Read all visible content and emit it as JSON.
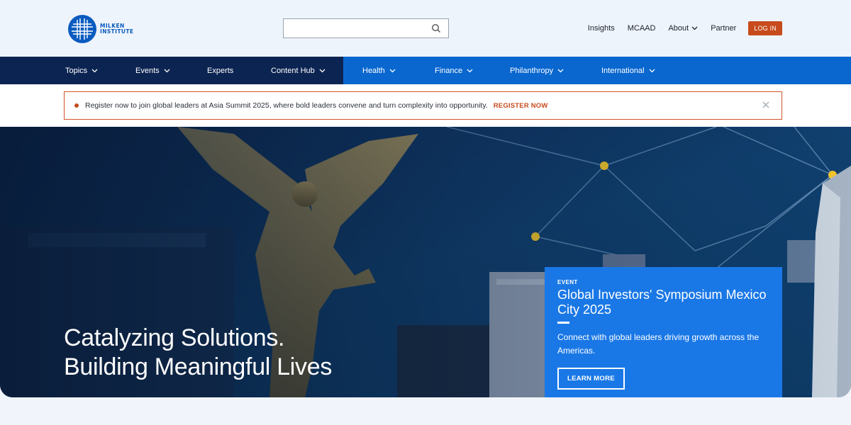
{
  "brand": {
    "logo_line1": "MILKEN",
    "logo_line2": "INSTITUTE",
    "brand_color": "#0a5bbf",
    "accent_color": "#c74b1c"
  },
  "search": {
    "placeholder": "",
    "value": "",
    "icon": "search-icon"
  },
  "utility_nav": {
    "insights": "Insights",
    "mcaad": "MCAAD",
    "about": "About",
    "partner": "Partner",
    "login": "LOG IN"
  },
  "main_nav": {
    "topics": "Topics",
    "events": "Events",
    "experts": "Experts",
    "content_hub": "Content Hub",
    "health": "Health",
    "finance": "Finance",
    "philanthropy": "Philanthropy",
    "international": "International"
  },
  "alert": {
    "message": "Register now to join global leaders at Asia Summit 2025, where bold leaders convene and turn complexity into opportunity.",
    "cta": "REGISTER NOW"
  },
  "hero": {
    "headline_line1": "Catalyzing Solutions.",
    "headline_line2": "Building Meaningful Lives"
  },
  "event_card": {
    "tag": "EVENT",
    "title": "Global Investors' Symposium Mexico City 2025",
    "description": "Connect with global leaders driving growth across the Americas.",
    "button": "LEARN MORE"
  }
}
